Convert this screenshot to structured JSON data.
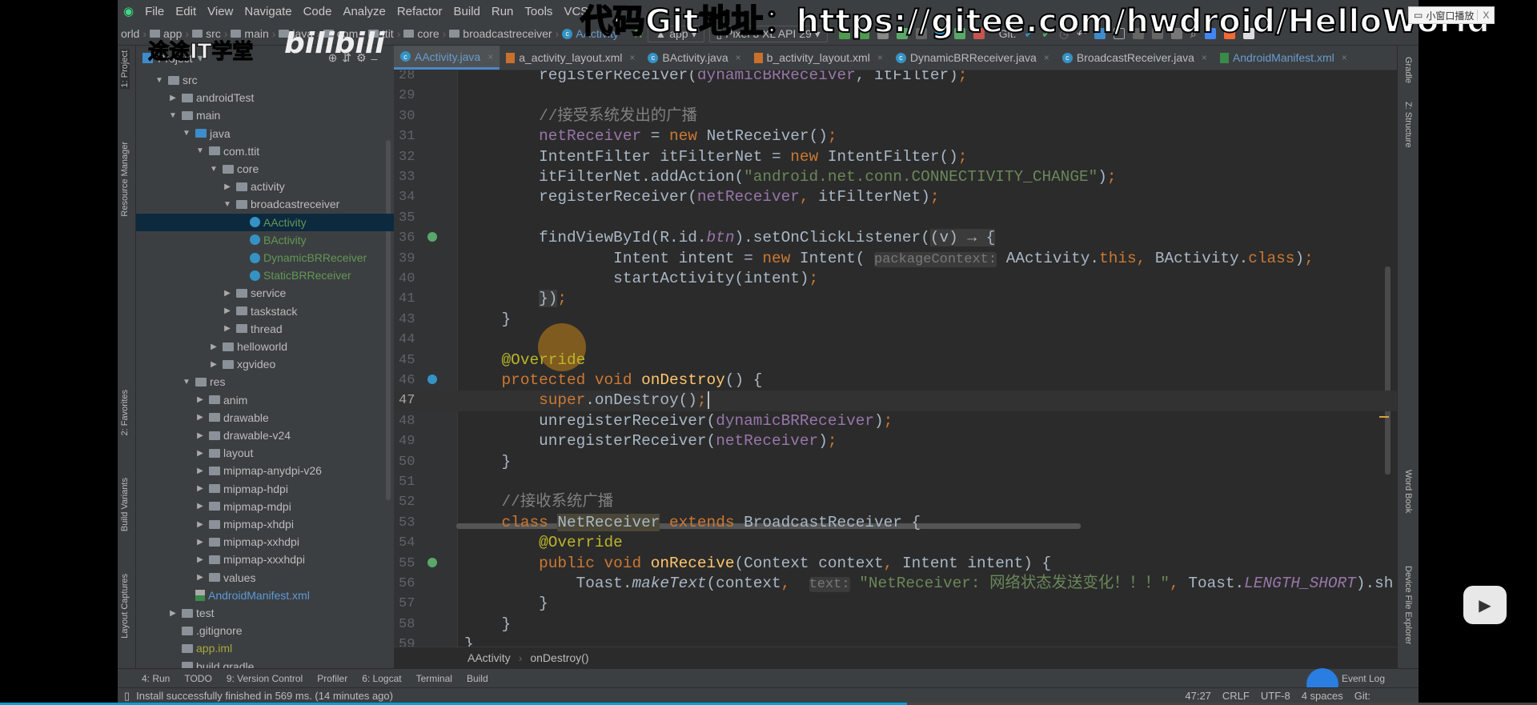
{
  "menu": [
    "File",
    "Edit",
    "View",
    "Navigate",
    "Code",
    "Analyze",
    "Refactor",
    "Build",
    "Run",
    "Tools",
    "VCS"
  ],
  "breadcrumb_nav": [
    "orld",
    "app",
    "src",
    "main",
    "java",
    "com",
    "ttit",
    "core",
    "broadcastreceiver",
    "AActivity"
  ],
  "run_config": "app",
  "device": "Pixel 3 XL API 29",
  "git_label": "Git:",
  "tabs": [
    {
      "label": "AActivity.java",
      "icon": "java-class-icon",
      "active": true
    },
    {
      "label": "a_activity_layout.xml",
      "icon": "xml-layout-icon"
    },
    {
      "label": "BActivity.java",
      "icon": "java-class-icon"
    },
    {
      "label": "b_activity_layout.xml",
      "icon": "xml-layout-icon"
    },
    {
      "label": "DynamicBRReceiver.java",
      "icon": "java-class-icon"
    },
    {
      "label": "BroadcastReceiver.java",
      "icon": "java-class-icon"
    },
    {
      "label": "AndroidManifest.xml",
      "icon": "manifest-icon"
    }
  ],
  "project_panel": {
    "title": "Project"
  },
  "left_strip": [
    "1: Project",
    "Resource Manager",
    "2: Favorites",
    "Build Variants",
    "Layout Captures"
  ],
  "right_strip": [
    "Gradle",
    "Z: Structure",
    "Word Book",
    "Device File Explorer"
  ],
  "tree": [
    {
      "label": "src",
      "depth": 2,
      "exp": "open",
      "type": "folder"
    },
    {
      "label": "androidTest",
      "depth": 3,
      "exp": "closed",
      "type": "folder"
    },
    {
      "label": "main",
      "depth": 3,
      "exp": "open",
      "type": "folder"
    },
    {
      "label": "java",
      "depth": 4,
      "exp": "open",
      "type": "src"
    },
    {
      "label": "com.ttit",
      "depth": 5,
      "exp": "open",
      "type": "package"
    },
    {
      "label": "core",
      "depth": 6,
      "exp": "open",
      "type": "package"
    },
    {
      "label": "activity",
      "depth": 7,
      "exp": "closed",
      "type": "package"
    },
    {
      "label": "broadcastreceiver",
      "depth": 7,
      "exp": "open",
      "type": "package"
    },
    {
      "label": "AActivity",
      "depth": 8,
      "type": "class",
      "selected": true
    },
    {
      "label": "BActivity",
      "depth": 8,
      "type": "class"
    },
    {
      "label": "DynamicBRReceiver",
      "depth": 8,
      "type": "class"
    },
    {
      "label": "StaticBRReceiver",
      "depth": 8,
      "type": "class"
    },
    {
      "label": "service",
      "depth": 7,
      "exp": "closed",
      "type": "package"
    },
    {
      "label": "taskstack",
      "depth": 7,
      "exp": "closed",
      "type": "package"
    },
    {
      "label": "thread",
      "depth": 7,
      "exp": "closed",
      "type": "package"
    },
    {
      "label": "helloworld",
      "depth": 6,
      "exp": "closed",
      "type": "package"
    },
    {
      "label": "xgvideo",
      "depth": 6,
      "exp": "closed",
      "type": "package"
    },
    {
      "label": "res",
      "depth": 4,
      "exp": "open",
      "type": "folder"
    },
    {
      "label": "anim",
      "depth": 5,
      "exp": "closed",
      "type": "package"
    },
    {
      "label": "drawable",
      "depth": 5,
      "exp": "closed",
      "type": "package"
    },
    {
      "label": "drawable-v24",
      "depth": 5,
      "exp": "closed",
      "type": "package"
    },
    {
      "label": "layout",
      "depth": 5,
      "exp": "closed",
      "type": "package"
    },
    {
      "label": "mipmap-anydpi-v26",
      "depth": 5,
      "exp": "closed",
      "type": "package"
    },
    {
      "label": "mipmap-hdpi",
      "depth": 5,
      "exp": "closed",
      "type": "package"
    },
    {
      "label": "mipmap-mdpi",
      "depth": 5,
      "exp": "closed",
      "type": "package"
    },
    {
      "label": "mipmap-xhdpi",
      "depth": 5,
      "exp": "closed",
      "type": "package"
    },
    {
      "label": "mipmap-xxhdpi",
      "depth": 5,
      "exp": "closed",
      "type": "package"
    },
    {
      "label": "mipmap-xxxhdpi",
      "depth": 5,
      "exp": "closed",
      "type": "package"
    },
    {
      "label": "values",
      "depth": 5,
      "exp": "closed",
      "type": "package"
    },
    {
      "label": "AndroidManifest.xml",
      "depth": 4,
      "type": "manifest"
    },
    {
      "label": "test",
      "depth": 3,
      "exp": "closed",
      "type": "folder"
    },
    {
      "label": ".gitignore",
      "depth": 3,
      "type": "file"
    },
    {
      "label": "app.iml",
      "depth": 3,
      "type": "iml"
    },
    {
      "label": "build.gradle",
      "depth": 3,
      "type": "file"
    }
  ],
  "code": [
    {
      "n": "28",
      "t": [
        [
          "        registerReceiver(",
          ""
        ],
        [
          "dynamicBRReceiver",
          "fld"
        ],
        [
          ", itFilter)",
          ""
        ],
        [
          ";",
          "kw"
        ]
      ]
    },
    {
      "n": "29",
      "t": []
    },
    {
      "n": "30",
      "t": [
        [
          "        //接受系统发出的广播",
          "cmt"
        ]
      ]
    },
    {
      "n": "31",
      "t": [
        [
          "        ",
          ""
        ],
        [
          "netReceiver",
          "fld"
        ],
        [
          " = ",
          ""
        ],
        [
          "new",
          "kw"
        ],
        [
          " NetReceiver()",
          ""
        ],
        [
          ";",
          "kw"
        ]
      ]
    },
    {
      "n": "32",
      "t": [
        [
          "        IntentFilter itFilterNet = ",
          ""
        ],
        [
          "new",
          "kw"
        ],
        [
          " IntentFilter()",
          ""
        ],
        [
          ";",
          "kw"
        ]
      ]
    },
    {
      "n": "33",
      "t": [
        [
          "        itFilterNet.addAction(",
          ""
        ],
        [
          "\"android.net.conn.CONNECTIVITY_CHANGE\"",
          "str"
        ],
        [
          ")",
          ""
        ],
        [
          ";",
          "kw"
        ]
      ]
    },
    {
      "n": "34",
      "t": [
        [
          "        registerReceiver(",
          ""
        ],
        [
          "netReceiver",
          "fld"
        ],
        [
          ", ",
          "kw"
        ],
        [
          "itFilterNet)",
          ""
        ],
        [
          ";",
          "kw"
        ]
      ]
    },
    {
      "n": "35",
      "t": []
    },
    {
      "n": "36",
      "t": [
        [
          "        findViewById(R.id.",
          ""
        ],
        [
          "btn",
          "it"
        ],
        [
          ").setOnClickListener(",
          ""
        ],
        [
          "(v) → {",
          "lam"
        ]
      ],
      "g": "green"
    },
    {
      "n": "39",
      "t": [
        [
          "                Intent intent = ",
          ""
        ],
        [
          "new",
          "kw"
        ],
        [
          " Intent( ",
          ""
        ],
        [
          "packageContext:",
          "hint"
        ],
        [
          " AActivity.",
          ""
        ],
        [
          "this",
          "kw"
        ],
        [
          ", ",
          "kw"
        ],
        [
          "BActivity.",
          ""
        ],
        [
          "class",
          "kw"
        ],
        [
          ")",
          ""
        ],
        [
          ";",
          "kw"
        ]
      ]
    },
    {
      "n": "40",
      "t": [
        [
          "                startActivity(intent)",
          ""
        ],
        [
          ";",
          "kw"
        ]
      ]
    },
    {
      "n": "41",
      "t": [
        [
          "        ",
          ""
        ],
        [
          "})",
          "lam"
        ],
        [
          ";",
          "kw"
        ]
      ]
    },
    {
      "n": "43",
      "t": [
        [
          "    }",
          ""
        ]
      ]
    },
    {
      "n": "44",
      "t": []
    },
    {
      "n": "45",
      "t": [
        [
          "    @Override",
          "ann"
        ]
      ]
    },
    {
      "n": "46",
      "t": [
        [
          "    ",
          ""
        ],
        [
          "protected void ",
          "kw"
        ],
        [
          "onDestroy",
          "md"
        ],
        [
          "() {",
          ""
        ]
      ],
      "g": "blue"
    },
    {
      "n": "47",
      "t": [
        [
          "        ",
          ""
        ],
        [
          "super",
          "kw"
        ],
        [
          ".onDestroy()",
          ""
        ],
        [
          ";",
          "kw"
        ]
      ],
      "current": true
    },
    {
      "n": "48",
      "t": [
        [
          "        unregisterReceiver(",
          ""
        ],
        [
          "dynamicBRReceiver",
          "fld"
        ],
        [
          ")",
          ""
        ],
        [
          ";",
          "kw"
        ]
      ]
    },
    {
      "n": "49",
      "t": [
        [
          "        unregisterReceiver(",
          ""
        ],
        [
          "netReceiver",
          "fld"
        ],
        [
          ")",
          ""
        ],
        [
          ";",
          "kw"
        ]
      ]
    },
    {
      "n": "50",
      "t": [
        [
          "    }",
          ""
        ]
      ]
    },
    {
      "n": "51",
      "t": []
    },
    {
      "n": "52",
      "t": [
        [
          "    //接收系统广播",
          "cmt"
        ]
      ]
    },
    {
      "n": "53",
      "t": [
        [
          "    ",
          ""
        ],
        [
          "class ",
          "kw"
        ],
        [
          "NetReceiver",
          "hl"
        ],
        [
          " extends ",
          "kw"
        ],
        [
          "BroadcastReceiver {",
          ""
        ]
      ]
    },
    {
      "n": "54",
      "t": [
        [
          "        @Override",
          "ann"
        ]
      ]
    },
    {
      "n": "55",
      "t": [
        [
          "        ",
          ""
        ],
        [
          "public void ",
          "kw"
        ],
        [
          "onReceive",
          "md"
        ],
        [
          "(Context context",
          ""
        ],
        [
          ", ",
          "kw"
        ],
        [
          "Intent intent) {",
          ""
        ]
      ],
      "g": "green"
    },
    {
      "n": "56",
      "t": [
        [
          "            Toast.",
          ""
        ],
        [
          "makeText",
          "itp"
        ],
        [
          "(context",
          ""
        ],
        [
          ", ",
          "kw"
        ],
        [
          " ",
          ""
        ],
        [
          "text:",
          "hint"
        ],
        [
          " \"NetReceiver: 网络状态发送变化！！！\"",
          "str"
        ],
        [
          ", ",
          "kw"
        ],
        [
          "Toast.",
          ""
        ],
        [
          "LENGTH_SHORT",
          "it"
        ],
        [
          ").sh",
          ""
        ]
      ]
    },
    {
      "n": "57",
      "t": [
        [
          "        }",
          ""
        ]
      ]
    },
    {
      "n": "58",
      "t": [
        [
          "    }",
          ""
        ]
      ]
    },
    {
      "n": "59",
      "t": [
        [
          "}",
          ""
        ]
      ]
    }
  ],
  "editor_breadcrumb": [
    "AActivity",
    "onDestroy()"
  ],
  "tool_windows": [
    "4: Run",
    "TODO",
    "9: Version Control",
    "Profiler",
    "6: Logcat",
    "Terminal",
    "Build"
  ],
  "event_log": "Event Log",
  "status": {
    "message": "Install successfully finished in 569 ms. (14 minutes ago)",
    "position": "47:27",
    "line_sep": "CRLF",
    "encoding": "UTF-8",
    "indent": "4 spaces",
    "git": "Git:"
  },
  "overlay": {
    "watermark": "代码Git地址：https://gitee.com/hwdroid/HelloWorld",
    "channel_logo": "途途IT学堂",
    "bili_logo": "bilibili",
    "mini_window": "小窗口播放",
    "mini_close": "X"
  },
  "video_progress_percent": 59,
  "colors": {
    "accent": "#4a88c7",
    "editor_bg": "#2b2b2b",
    "keyword": "#cc7832",
    "string": "#6a8759",
    "field": "#9876aa",
    "progress": "#00a1d6"
  }
}
